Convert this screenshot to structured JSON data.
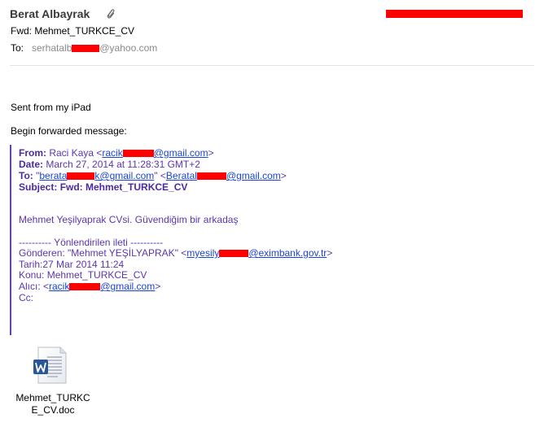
{
  "header": {
    "sender": "Berat Albayrak",
    "subject": "Fwd: Mehmet_TURKCE_CV",
    "to_label": "To:",
    "to_prefix": "serhatalb",
    "to_suffix": "@yahoo.com"
  },
  "body": {
    "line1": "Sent from my iPad",
    "line2": "Begin forwarded message:"
  },
  "forwarded": {
    "from_label": "From:",
    "from_name": "Raci Kaya <",
    "from_email_start": "racik",
    "from_email_end": "@gmail.com",
    "from_close": ">",
    "date_label": "Date:",
    "date_value": "March 27, 2014 at 11:28:31 GMT+2",
    "to_label": "To:",
    "to_q1": "\"",
    "to_email1_start": "berata",
    "to_email1_end": "k@gmail.com",
    "to_q2": "\" <",
    "to_email2_start": "Beratal",
    "to_email2_end": "@gmail.com",
    "to_close": ">",
    "subject_label": "Subject:",
    "subject_value": "Fwd: Mehmet_TURKCE_CV"
  },
  "inner": {
    "intro": "Mehmet Yeşilyaprak CVsi. Güvendiğim bir arkadaş",
    "separator": "---------- Yönlendirilen ileti ----------",
    "sender_label": "Gönderen: \"Mehmet YEŞİLYAPRAK\" <",
    "sender_email_start": "myesily",
    "sender_email_end": "@eximbank.gov.tr",
    "sender_close": ">",
    "date_line": "Tarih:27 Mar 2014 11:24",
    "subject_line": "Konu: Mehmet_TURKCE_CV",
    "recipient_label": "Alıcı: <",
    "recipient_email_start": "racik",
    "recipient_email_end": "@gmail.com",
    "recipient_close": ">",
    "cc_line": "Cc:"
  },
  "attachment": {
    "icon": "word-doc-icon",
    "filename": "Mehmet_TURKCE_CV.doc"
  },
  "colors": {
    "quote": "#5b35b0",
    "link": "#1a44d8",
    "redaction": "#ff0000"
  }
}
